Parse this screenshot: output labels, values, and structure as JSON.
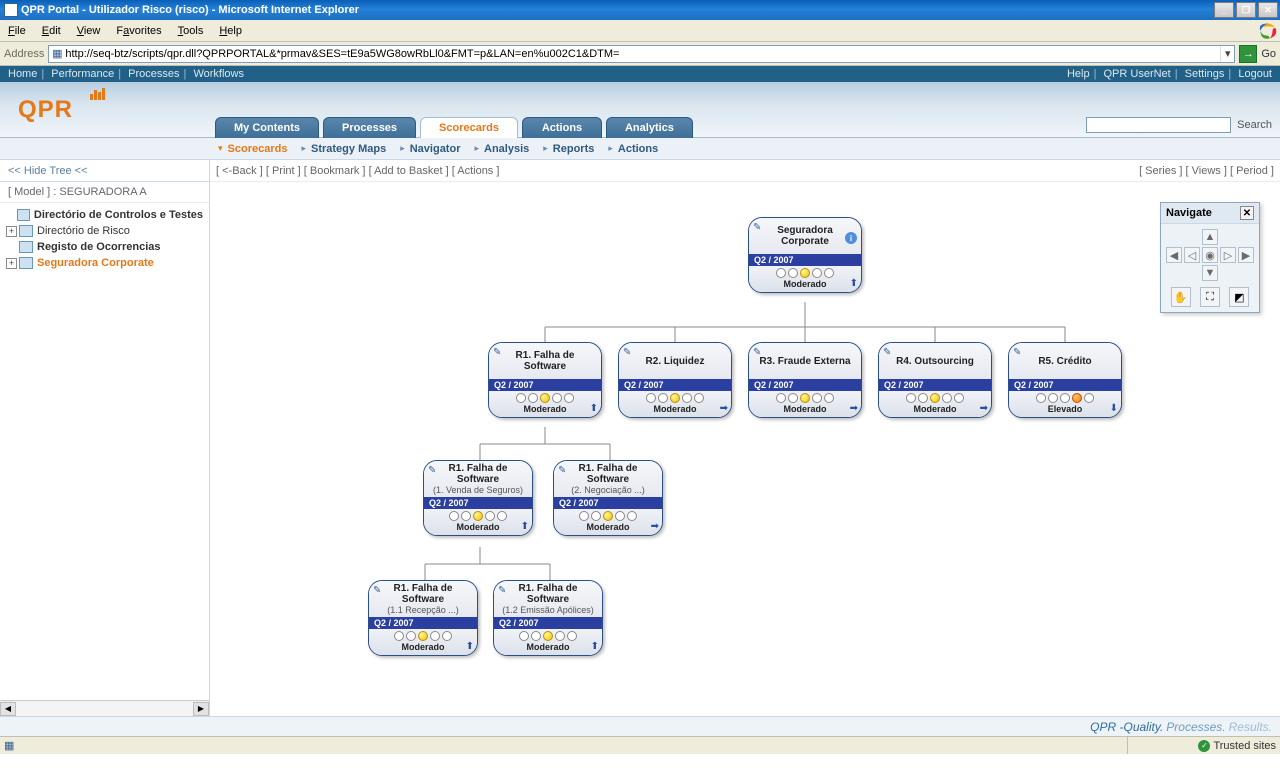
{
  "window": {
    "title": "QPR Portal - Utilizador Risco (risco) - Microsoft Internet Explorer"
  },
  "menubar": {
    "items": [
      "File",
      "Edit",
      "View",
      "Favorites",
      "Tools",
      "Help"
    ]
  },
  "address": {
    "label": "Address",
    "url": "http://seq-btz/scripts/qpr.dll?QPRPORTAL&*prmav&SES=tE9a5WG8owRbLl0&FMT=p&LAN=en%u002C1&DTM=",
    "go": "Go"
  },
  "topnav": {
    "left": [
      "Home",
      "Performance",
      "Processes",
      "Workflows"
    ],
    "right": [
      "Help",
      "QPR UserNet",
      "Settings",
      "Logout"
    ]
  },
  "brand": "QPR",
  "tabs": [
    "My Contents",
    "Processes",
    "Scorecards",
    "Actions",
    "Analytics"
  ],
  "active_tab": 2,
  "subtabs": [
    "Scorecards",
    "Strategy Maps",
    "Navigator",
    "Analysis",
    "Reports",
    "Actions"
  ],
  "active_subtab": 0,
  "search": {
    "label": "Search"
  },
  "sidebar": {
    "hide": "<< Hide Tree <<",
    "model": "[ Model ] : SEGURADORA A",
    "nodes": [
      {
        "label": "Directório de Controlos e Testes",
        "bold": true,
        "expander": ""
      },
      {
        "label": "Directório de Risco",
        "bold": false,
        "expander": "+"
      },
      {
        "label": "Registo de Ocorrencias",
        "bold": true,
        "expander": ""
      },
      {
        "label": "Seguradora Corporate",
        "bold": true,
        "expander": "+",
        "active": true
      }
    ]
  },
  "toolbar_left": [
    "[ <-Back ]",
    "[ Print ]",
    "[ Bookmark ]",
    "[ Add to Basket ]",
    "[ Actions ]"
  ],
  "toolbar_right": [
    "[ Series ]",
    "[ Views ]",
    "[ Period ]"
  ],
  "navigate_panel": {
    "title": "Navigate"
  },
  "chart_data": {
    "type": "tree",
    "period": "Q2 / 2007",
    "status_labels": {
      "moderado": "Moderado",
      "elevado": "Elevado"
    },
    "root": {
      "title": "Seguradora Corporate",
      "period": "Q2 / 2007",
      "status": "Moderado",
      "dot": "yellow",
      "trend": "up",
      "children": [
        {
          "title": "R1. Falha de Software",
          "period": "Q2 / 2007",
          "status": "Moderado",
          "dot": "yellow",
          "trend": "up",
          "children": [
            {
              "title": "R1. Falha de Software",
              "sub": "(1. Venda de Seguros)",
              "period": "Q2 / 2007",
              "status": "Moderado",
              "dot": "yellow",
              "trend": "up",
              "children": [
                {
                  "title": "R1. Falha de Software",
                  "sub": "(1.1 Recepção ...)",
                  "period": "Q2 / 2007",
                  "status": "Moderado",
                  "dot": "yellow",
                  "trend": "up"
                },
                {
                  "title": "R1. Falha de Software",
                  "sub": "(1.2 Emissão Apólices)",
                  "period": "Q2 / 2007",
                  "status": "Moderado",
                  "dot": "yellow",
                  "trend": "up"
                }
              ]
            },
            {
              "title": "R1. Falha de Software",
              "sub": "(2. Negociação ...)",
              "period": "Q2 / 2007",
              "status": "Moderado",
              "dot": "yellow",
              "trend": "right"
            }
          ]
        },
        {
          "title": "R2. Liquidez",
          "period": "Q2 / 2007",
          "status": "Moderado",
          "dot": "yellow",
          "trend": "right"
        },
        {
          "title": "R3. Fraude Externa",
          "period": "Q2 / 2007",
          "status": "Moderado",
          "dot": "yellow",
          "trend": "right"
        },
        {
          "title": "R4. Outsourcing",
          "period": "Q2 / 2007",
          "status": "Moderado",
          "dot": "yellow",
          "trend": "right"
        },
        {
          "title": "R5. Crédito",
          "period": "Q2 / 2007",
          "status": "Elevado",
          "dot": "orange",
          "trend": "down"
        }
      ]
    }
  },
  "footer": {
    "slogan1": "QPR -",
    "slogan2": "Quality.",
    "slogan3": "Processes.",
    "slogan4": "Results."
  },
  "status": {
    "right": "Trusted sites"
  }
}
